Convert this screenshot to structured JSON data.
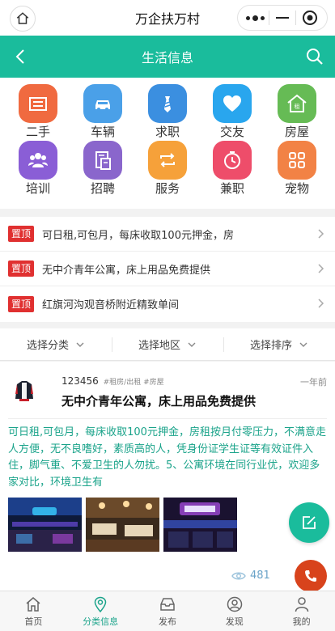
{
  "mp_bar": {
    "title": "万企扶万村"
  },
  "header": {
    "title": "生活信息"
  },
  "categories": [
    {
      "label": "二手",
      "color": "#f06a40",
      "icon": "second-hand-icon"
    },
    {
      "label": "车辆",
      "color": "#4aa0e8",
      "icon": "car-icon"
    },
    {
      "label": "求职",
      "color": "#3b8fe0",
      "icon": "tie-icon"
    },
    {
      "label": "交友",
      "color": "#29a6ee",
      "icon": "heart-icon"
    },
    {
      "label": "房屋",
      "color": "#66bb55",
      "icon": "house-icon"
    },
    {
      "label": "培训",
      "color": "#8a5ed6",
      "icon": "people-icon"
    },
    {
      "label": "招聘",
      "color": "#8a66cc",
      "icon": "resume-icon"
    },
    {
      "label": "服务",
      "color": "#f6a13a",
      "icon": "swap-icon"
    },
    {
      "label": "兼职",
      "color": "#ee4d6a",
      "icon": "clock-icon"
    },
    {
      "label": "宠物",
      "color": "#f28245",
      "icon": "grid-icon"
    }
  ],
  "pinned": {
    "badge": "置顶",
    "items": [
      "可日租,可包月，每床收取100元押金，房",
      "无中介青年公寓，床上用品免费提供",
      "红旗河沟观音桥附近精致单间"
    ]
  },
  "filters": [
    "选择分类",
    "选择地区",
    "选择排序"
  ],
  "post": {
    "user": "123456",
    "tags": "#租房/出租 #房屋",
    "time": "一年前",
    "title": "无中介青年公寓，床上用品免费提供",
    "body": "可日租,可包月，每床收取100元押金，房租按月付零压力，不满意走人方便，无不良嗜好，素质高的人，凭身份证学生证等有效证件入住，脚气重、不爱卫生的人勿扰。5、公寓环境在同行业优，欢迎多家对比，环境卫生有",
    "views": "481"
  },
  "tabs": [
    {
      "label": "首页",
      "icon": "home-icon",
      "active": false
    },
    {
      "label": "分类信息",
      "icon": "location-pin-icon",
      "active": true
    },
    {
      "label": "发布",
      "icon": "inbox-icon",
      "active": false
    },
    {
      "label": "发现",
      "icon": "discover-icon",
      "active": false
    },
    {
      "label": "我的",
      "icon": "user-icon",
      "active": false
    }
  ],
  "colors": {
    "accent": "#1abc9c",
    "pin_badge": "#e03030",
    "call_button": "#d8431c"
  }
}
